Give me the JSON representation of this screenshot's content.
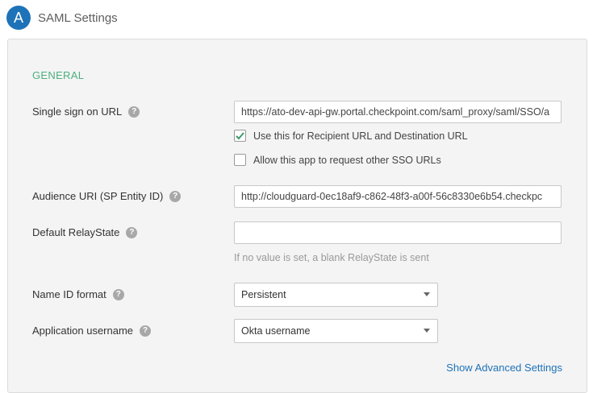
{
  "header": {
    "avatar_letter": "A",
    "title": "SAML Settings"
  },
  "section": {
    "title": "GENERAL"
  },
  "sso_url": {
    "label": "Single sign on URL",
    "help": "?",
    "value": "https://ato-dev-api-gw.portal.checkpoint.com/saml_proxy/saml/SSO/a",
    "recipient_checkbox": {
      "checked": true,
      "label": "Use this for Recipient URL and Destination URL"
    },
    "allow_checkbox": {
      "checked": false,
      "label": "Allow this app to request other SSO URLs"
    }
  },
  "audience_uri": {
    "label": "Audience URI (SP Entity ID)",
    "help": "?",
    "value": "http://cloudguard-0ec18af9-c862-48f3-a00f-56c8330e6b54.checkpc"
  },
  "relay_state": {
    "label": "Default RelayState",
    "help": "?",
    "value": "",
    "hint": "If no value is set, a blank RelayState is sent"
  },
  "name_id_format": {
    "label": "Name ID format",
    "help": "?",
    "selected": "Persistent"
  },
  "app_username": {
    "label": "Application username",
    "help": "?",
    "selected": "Okta username"
  },
  "advanced_link": "Show Advanced Settings",
  "colors": {
    "accent": "#1e72b8",
    "section": "#4caf7e",
    "panel": "#f4f4f4"
  }
}
